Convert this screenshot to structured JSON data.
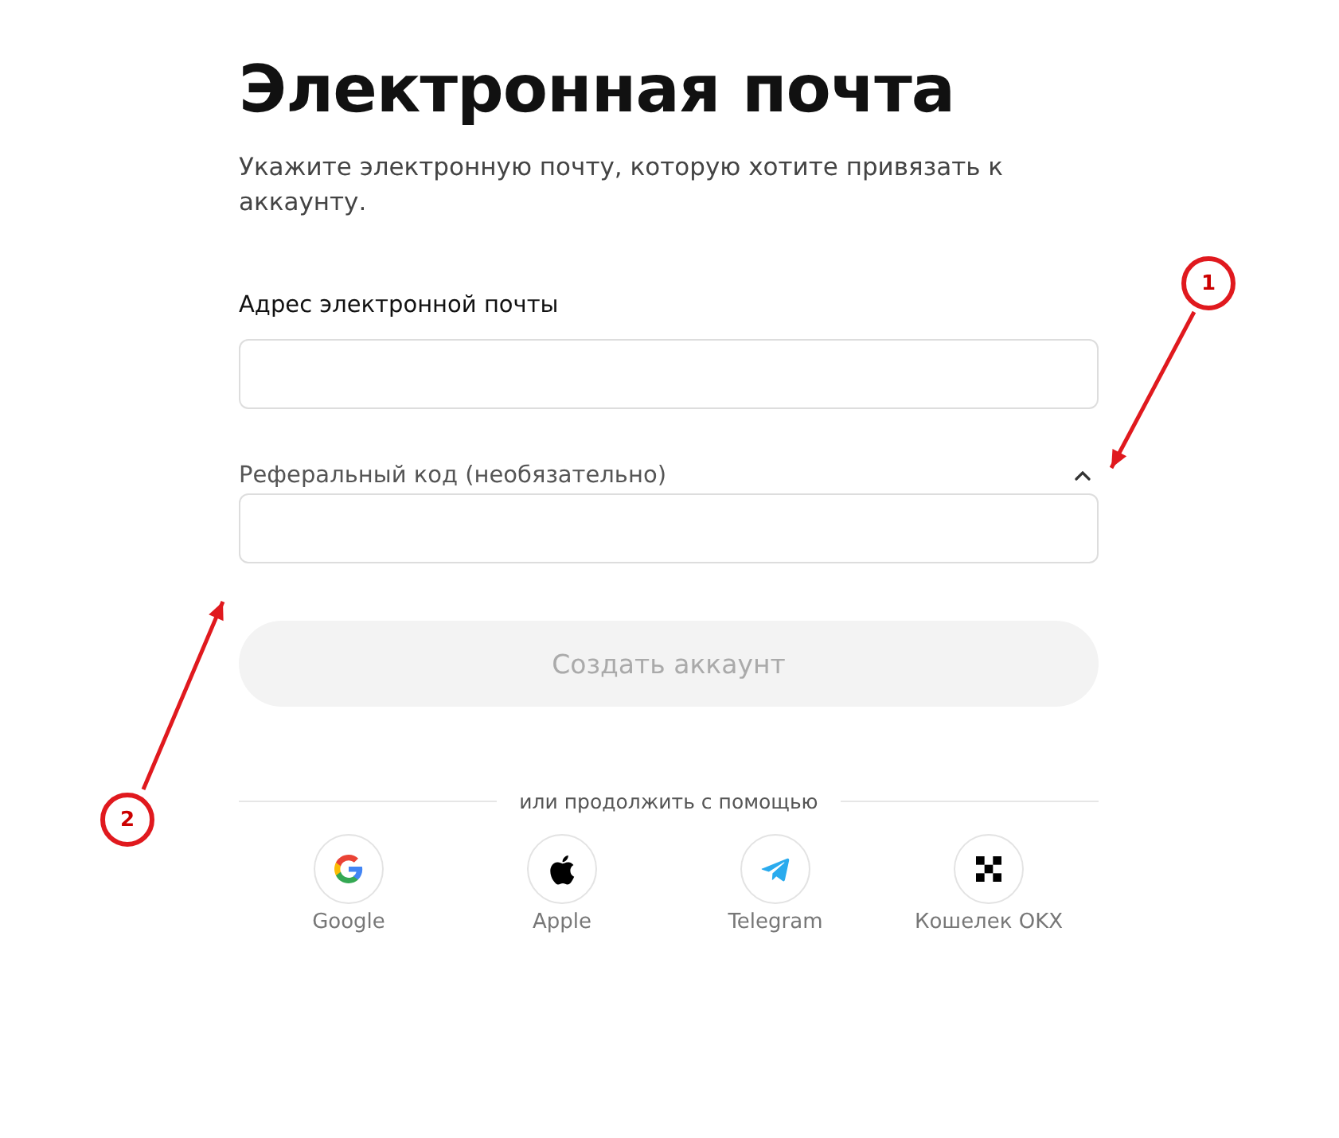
{
  "title": "Электронная почта",
  "subtitle": "Укажите электронную почту, которую хотите привязать к аккаунту.",
  "email_field": {
    "label": "Адрес электронной почты"
  },
  "referral_field": {
    "label": "Реферальный код (необязательно)",
    "expanded": true
  },
  "submit_button": {
    "label": "Создать аккаунт",
    "disabled": true
  },
  "divider_text": "или продолжить с помощью",
  "social_logins": [
    {
      "kind": "google",
      "label": "Google"
    },
    {
      "kind": "apple",
      "label": "Apple"
    },
    {
      "kind": "telegram",
      "label": "Telegram"
    },
    {
      "kind": "okx",
      "label": "Кошелек OKX"
    }
  ],
  "annotations": [
    {
      "label": "1"
    },
    {
      "label": "2"
    }
  ]
}
